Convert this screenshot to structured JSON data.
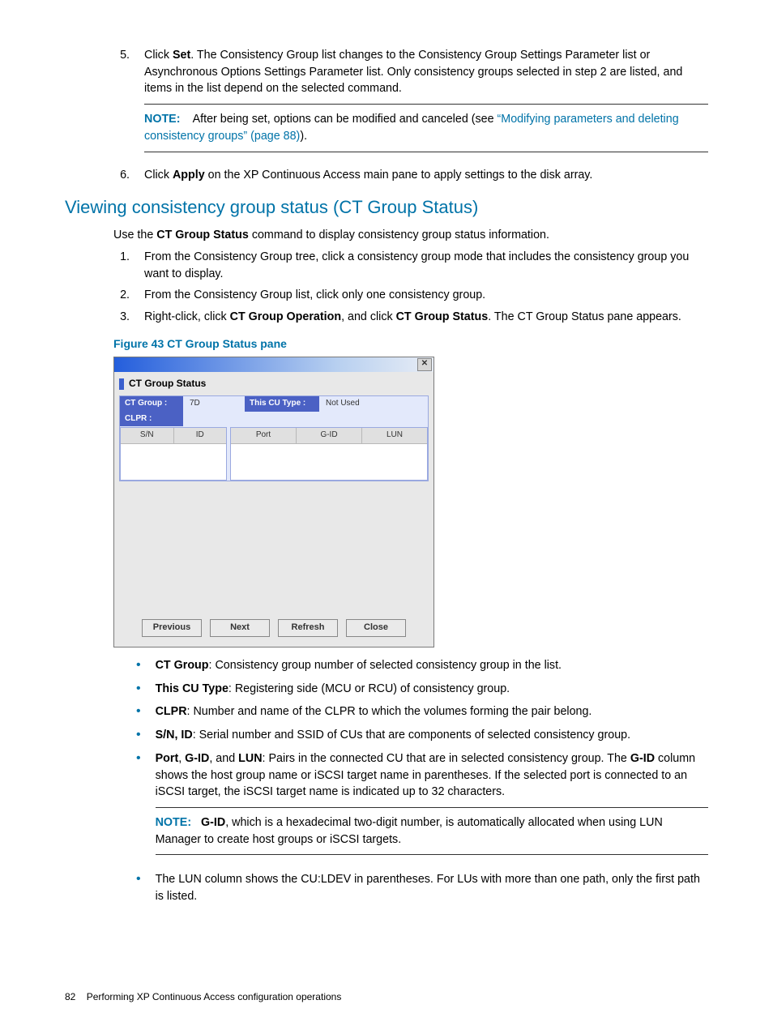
{
  "steps_a": [
    {
      "num": "5.",
      "parts": [
        {
          "t": "plain",
          "v": "Click "
        },
        {
          "t": "b",
          "v": "Set"
        },
        {
          "t": "plain",
          "v": ". The Consistency Group list changes to the Consistency Group Settings Parameter list or Asynchronous Options Settings Parameter list. Only consistency groups selected in step 2 are listed, and items in the list depend on the selected command."
        }
      ],
      "note": {
        "label": "NOTE:",
        "pre": "After being set, options can be modified and canceled (see ",
        "link": "“Modifying parameters and deleting consistency groups” (page 88)",
        "post": ")."
      }
    },
    {
      "num": "6.",
      "parts": [
        {
          "t": "plain",
          "v": "Click "
        },
        {
          "t": "b",
          "v": "Apply"
        },
        {
          "t": "plain",
          "v": " on the XP Continuous Access main pane to apply settings to the disk array."
        }
      ]
    }
  ],
  "section_title": "Viewing consistency group status (CT Group Status)",
  "intro": {
    "pre": "Use the ",
    "bold": "CT Group Status",
    "post": " command to display consistency group status information."
  },
  "steps_b": [
    {
      "num": "1.",
      "text": "From the Consistency Group tree, click a consistency group mode that includes the consistency group you want to display."
    },
    {
      "num": "2.",
      "text": "From the Consistency Group list, click only one consistency group."
    },
    {
      "num": "3.",
      "parts": [
        {
          "t": "plain",
          "v": "Right-click, click "
        },
        {
          "t": "b",
          "v": "CT Group Operation"
        },
        {
          "t": "plain",
          "v": ", and click "
        },
        {
          "t": "b",
          "v": "CT Group Status"
        },
        {
          "t": "plain",
          "v": ". The CT Group Status pane appears."
        }
      ]
    }
  ],
  "figure_caption": "Figure 43 CT Group Status pane",
  "figure": {
    "title": "CT Group Status",
    "ctgroup_label": "CT Group :",
    "ctgroup_value": "7D",
    "thiscu_label": "This CU Type :",
    "thiscu_value": "Not Used",
    "clpr_label": "CLPR :",
    "left_cols": [
      "S/N",
      "ID"
    ],
    "right_cols": [
      "Port",
      "G-ID",
      "LUN"
    ],
    "buttons": [
      "Previous",
      "Next",
      "Refresh",
      "Close"
    ]
  },
  "bullets": [
    {
      "bold": "CT Group",
      "rest": ": Consistency group number of selected consistency group in the list."
    },
    {
      "bold": "This CU Type",
      "rest": ": Registering side (MCU or RCU) of consistency group."
    },
    {
      "bold": "CLPR",
      "rest": ": Number and name of the CLPR to which the volumes forming the pair belong."
    },
    {
      "bold": "S/N, ID",
      "rest": ": Serial number and SSID of CUs that are components of selected consistency group."
    },
    {
      "bold": "Port",
      "mid": ", ",
      "bold2": "G-ID",
      "mid2": ", and ",
      "bold3": "LUN",
      "rest": ": Pairs in the connected CU that are in selected consistency group. The ",
      "bold4": "G-ID",
      "rest2": " column shows the host group name or iSCSI target name in parentheses. If the selected port is connected to an iSCSI target, the iSCSI target name is indicated up to 32 characters.",
      "note": {
        "label": "NOTE:",
        "bold": "G-ID",
        "rest": ", which is a hexadecimal two-digit number, is automatically allocated when using LUN Manager to create host groups or iSCSI targets."
      }
    },
    {
      "plain": "The LUN column shows the CU:LDEV in parentheses. For LUs with more than one path, only the first path is listed."
    }
  ],
  "footer": {
    "pagenum": "82",
    "chapter": "Performing XP Continuous Access configuration operations"
  }
}
